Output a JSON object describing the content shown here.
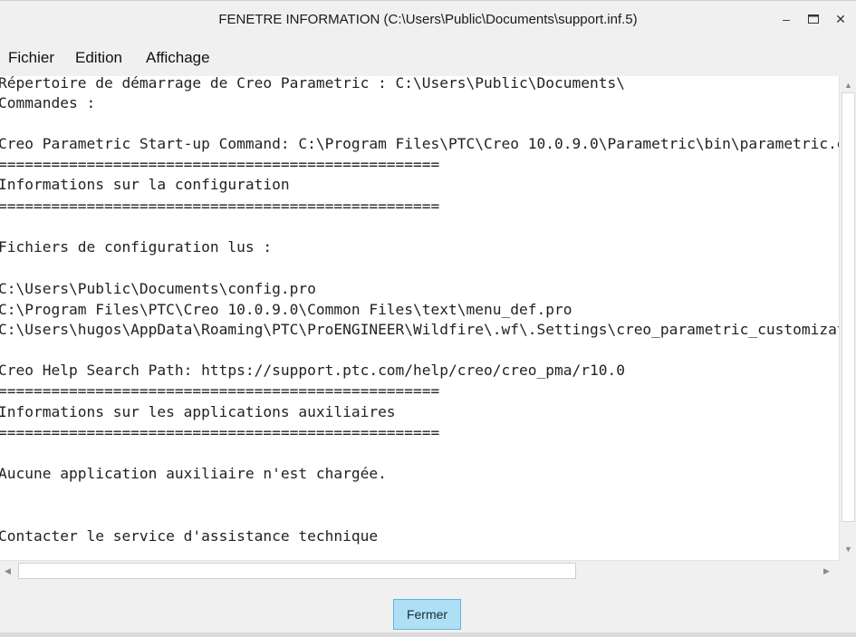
{
  "window": {
    "title": "FENETRE INFORMATION (C:\\Users\\Public\\Documents\\support.inf.5)"
  },
  "controls": {
    "minimize": "–",
    "maximize": "▭",
    "close": "✕"
  },
  "menu": {
    "items": [
      "Fichier",
      "Edition",
      "Affichage"
    ]
  },
  "content": {
    "lines": [
      "Répertoire de démarrage de Creo Parametric : C:\\Users\\Public\\Documents\\",
      "Commandes :",
      "",
      "Creo Parametric Start-up Command: C:\\Program Files\\PTC\\Creo 10.0.9.0\\Parametric\\bin\\parametric.exe",
      "==================================================",
      "Informations sur la configuration",
      "==================================================",
      "",
      "Fichiers de configuration lus :",
      "",
      "C:\\Users\\Public\\Documents\\config.pro",
      "C:\\Program Files\\PTC\\Creo 10.0.9.0\\Common Files\\text\\menu_def.pro",
      "C:\\Users\\hugos\\AppData\\Roaming\\PTC\\ProENGINEER\\Wildfire\\.wf\\.Settings\\creo_parametric_customization.ui",
      "",
      "Creo Help Search Path: https://support.ptc.com/help/creo/creo_pma/r10.0",
      "==================================================",
      "Informations sur les applications auxiliaires",
      "==================================================",
      "",
      "Aucune application auxiliaire n'est chargée.",
      "",
      "",
      "Contacter le service d'assistance technique"
    ]
  },
  "footer": {
    "close_button": "Fermer"
  },
  "colors": {
    "button_bg": "#aee0f5",
    "button_border": "#5fb7dc"
  }
}
